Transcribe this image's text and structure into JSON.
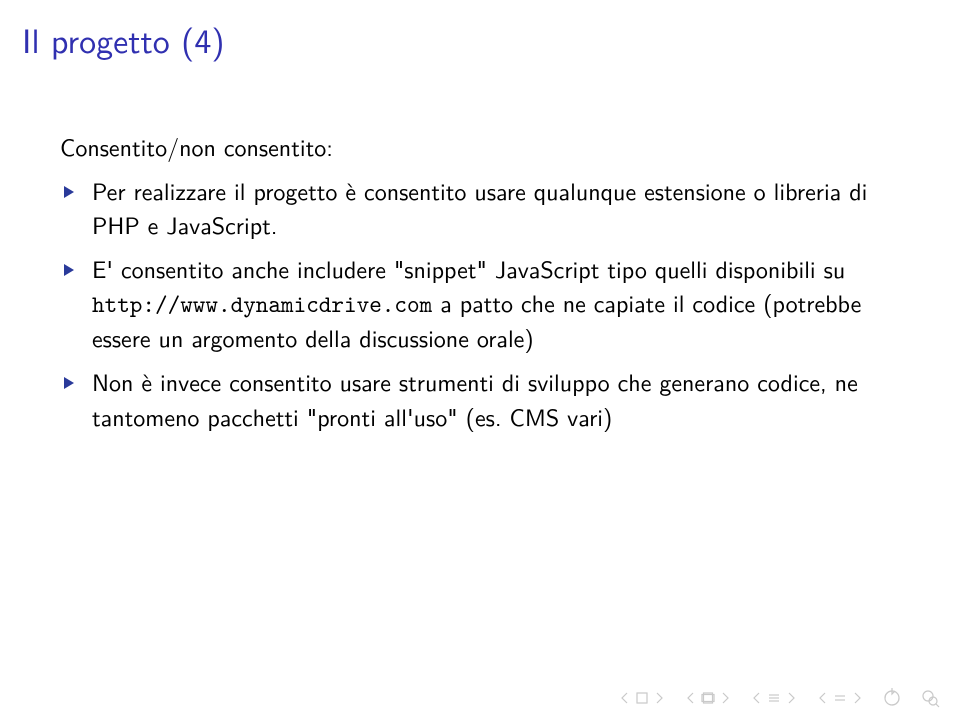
{
  "title": "Il progetto (4)",
  "intro": "Consentito/non consentito:",
  "items": [
    {
      "pre": "Per realizzare il progetto è consentito usare qualunque estensione o libreria di PHP e JavaScript."
    },
    {
      "pre": "E' consentito anche includere \"snippet\" JavaScript tipo quelli disponibili su ",
      "tt": "http://www.dynamicdrive.com",
      "post": " a patto che ne capiate il codice (potrebbe essere un argomento della discussione orale)"
    },
    {
      "pre": "Non è invece consentito usare strumenti di sviluppo che generano codice, ne tantomeno pacchetti \"pronti all'uso\" (es. CMS vari)"
    }
  ]
}
